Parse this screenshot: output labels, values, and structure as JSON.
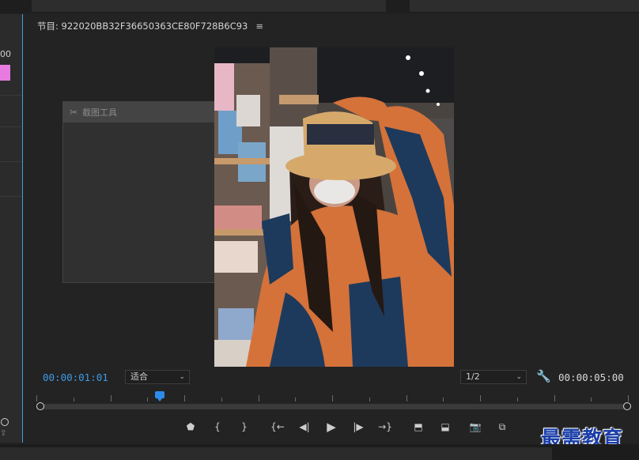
{
  "left_panel": {
    "timecode_fragment": "00"
  },
  "monitor": {
    "title": "节目: 922020BB32F36650363CE80F728B6C93",
    "menu_icon": "hamburger-icon",
    "current_timecode": "00:00:01:01",
    "duration_timecode": "00:00:05:00",
    "zoom_select": {
      "value": "适合"
    },
    "resolution_select": {
      "value": "1/2"
    },
    "settings_icon": "wrench-icon",
    "playhead_position": 0.2
  },
  "ghost_panel": {
    "title": "截图工具",
    "icon": "scissors-icon"
  },
  "controls": [
    {
      "name": "add-marker-button",
      "icon": "marker-icon",
      "glyph": "⬟"
    },
    {
      "name": "mark-in-button",
      "icon": "mark-in-icon",
      "glyph": "{"
    },
    {
      "name": "mark-out-button",
      "icon": "mark-out-icon",
      "glyph": "}"
    },
    {
      "name": "go-to-in-button",
      "icon": "go-to-in-icon",
      "glyph": "{←"
    },
    {
      "name": "step-back-button",
      "icon": "step-back-icon",
      "glyph": "◀|"
    },
    {
      "name": "play-button",
      "icon": "play-icon",
      "glyph": "▶"
    },
    {
      "name": "step-forward-button",
      "icon": "step-forward-icon",
      "glyph": "|▶"
    },
    {
      "name": "go-to-out-button",
      "icon": "go-to-out-icon",
      "glyph": "→}"
    },
    {
      "name": "lift-button",
      "icon": "lift-icon",
      "glyph": "⬒"
    },
    {
      "name": "extract-button",
      "icon": "extract-icon",
      "glyph": "⬓"
    },
    {
      "name": "export-frame-button",
      "icon": "camera-icon",
      "glyph": "📷"
    },
    {
      "name": "comparison-view-button",
      "icon": "comparison-view-icon",
      "glyph": "⧉"
    }
  ],
  "watermark": "最需教育",
  "colors": {
    "accent": "#3d9be9",
    "background": "#232323",
    "panel": "#2b2b2b"
  }
}
